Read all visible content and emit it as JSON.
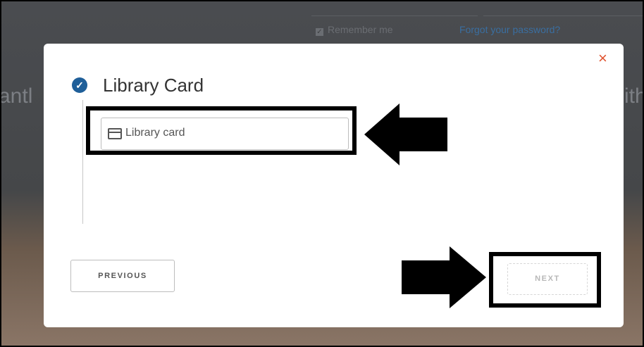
{
  "background": {
    "remember_me": "Remember me",
    "forgot_password": "Forgot your password?",
    "side_text_left": "antl",
    "side_text_right": "ith"
  },
  "modal": {
    "close_glyph": "×",
    "step": {
      "title": "Library Card",
      "status_icon": "check-circle-icon"
    },
    "library_card_input": {
      "placeholder": "Library card",
      "value": "",
      "icon": "credit-card-icon"
    },
    "buttons": {
      "previous": "PREVIOUS",
      "next": "NEXT"
    }
  },
  "colors": {
    "accent": "#1f5f99",
    "close": "#e0532f",
    "annotation": "#000000"
  }
}
